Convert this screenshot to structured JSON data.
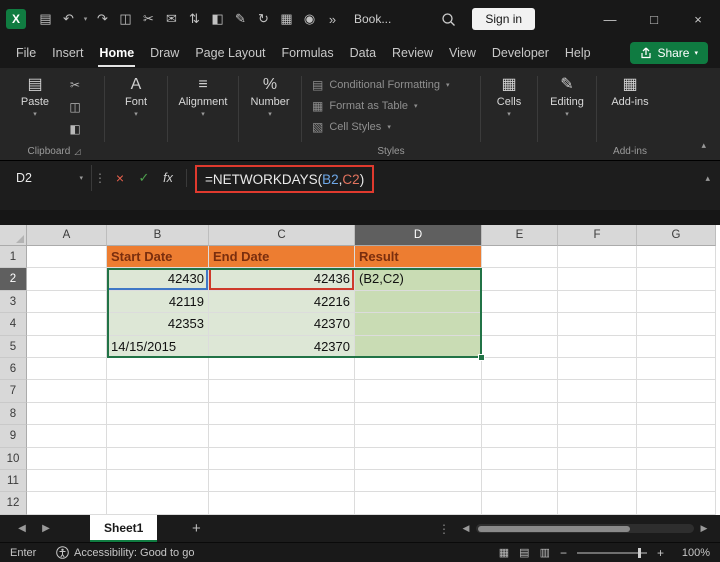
{
  "titlebar": {
    "qat": [
      {
        "name": "save-icon",
        "glyph": "▤"
      },
      {
        "name": "undo-icon",
        "glyph": "↶"
      },
      {
        "name": "undo-dropdown-icon",
        "glyph": "▾"
      },
      {
        "name": "redo-icon",
        "glyph": "↷"
      },
      {
        "name": "copy-icon",
        "glyph": "◫"
      },
      {
        "name": "cut-icon",
        "glyph": "✂"
      },
      {
        "name": "mail-icon",
        "glyph": "✉"
      },
      {
        "name": "sort-icon",
        "glyph": "⇅"
      },
      {
        "name": "format-painter-icon",
        "glyph": "◧"
      },
      {
        "name": "pen-icon",
        "glyph": "✎"
      },
      {
        "name": "rotate-icon",
        "glyph": "↻"
      },
      {
        "name": "table-icon",
        "glyph": "▦"
      },
      {
        "name": "camera-icon",
        "glyph": "◉"
      },
      {
        "name": "more-commands-icon",
        "glyph": "»"
      }
    ],
    "workbook_name": "Book...",
    "sign_in_label": "Sign in",
    "window": {
      "minimize": "—",
      "maximize": "□",
      "close": "×"
    }
  },
  "menubar": {
    "items": [
      "File",
      "Insert",
      "Home",
      "Draw",
      "Page Layout",
      "Formulas",
      "Data",
      "Review",
      "View",
      "Developer",
      "Help"
    ],
    "active_item": "Home",
    "share_label": "Share"
  },
  "ribbon": {
    "paste": {
      "glyph": "▤",
      "label": "Paste"
    },
    "mini": [
      {
        "glyph": "✂"
      },
      {
        "glyph": "◫"
      },
      {
        "glyph": "◧"
      }
    ],
    "big": [
      {
        "glyph": "A",
        "label": "Font"
      },
      {
        "glyph": "≡",
        "label": "Alignment"
      },
      {
        "glyph": "%",
        "label": "Number"
      }
    ],
    "styles": [
      {
        "glyph": "▤",
        "label": "Conditional Formatting"
      },
      {
        "glyph": "▦",
        "label": "Format as Table"
      },
      {
        "glyph": "▧",
        "label": "Cell Styles"
      }
    ],
    "right": [
      {
        "glyph": "▦",
        "label": "Cells"
      },
      {
        "glyph": "✎",
        "label": "Editing"
      },
      {
        "glyph": "▦",
        "label": "Add-ins"
      }
    ],
    "captions": {
      "clipboard": "Clipboard",
      "styles": "Styles",
      "addins": "Add-ins"
    },
    "launcher_glyph": "◿",
    "collapse_glyph": "▴"
  },
  "ui": {
    "caret": "▾",
    "dots": "⋮"
  },
  "formula_bar": {
    "name_box": "D2",
    "cancel_glyph": "×",
    "enter_glyph": "✓",
    "fx_label": "fx",
    "formula": {
      "prefix": "=NETWORKDAYS(",
      "ref1": "B2",
      "sep": ",",
      "ref2": "C2",
      "suffix": ")"
    },
    "collapse_glyph": "▴"
  },
  "grid": {
    "columns": [
      "A",
      "B",
      "C",
      "D",
      "E",
      "F",
      "G"
    ],
    "col_widths": {
      "A": 80,
      "B": 102,
      "C": 146,
      "D": 127,
      "E": 76,
      "F": 79,
      "G": 79
    },
    "rows": [
      "1",
      "2",
      "3",
      "4",
      "5",
      "6",
      "7",
      "8",
      "9",
      "10",
      "11",
      "12"
    ],
    "active_col": "D",
    "active_row": "2",
    "active_cell": "D2",
    "cells": {
      "B1": {
        "v": "Start Date",
        "cls": "hdr"
      },
      "C1": {
        "v": "End Date",
        "cls": "hdr"
      },
      "D1": {
        "v": "Result",
        "cls": "hdr"
      },
      "B2": {
        "v": "42430",
        "cls": "in num ref-blue"
      },
      "C2": {
        "v": "42436",
        "cls": "in num ref-red"
      },
      "D2": {
        "v": "(B2,C2)",
        "cls": "res"
      },
      "B3": {
        "v": "42119",
        "cls": "in num"
      },
      "C3": {
        "v": "42216",
        "cls": "in num"
      },
      "D3": {
        "v": "",
        "cls": "res"
      },
      "B4": {
        "v": "42353",
        "cls": "in num"
      },
      "C4": {
        "v": "42370",
        "cls": "in num"
      },
      "D4": {
        "v": "",
        "cls": "res"
      },
      "B5": {
        "v": "14/15/2015",
        "cls": "in"
      },
      "C5": {
        "v": "42370",
        "cls": "in num"
      },
      "D5": {
        "v": "",
        "cls": "res"
      }
    }
  },
  "sheet_bar": {
    "nav_left": "◀",
    "nav_right": "▶",
    "tab": "Sheet1",
    "add": "+",
    "dots": "⋮",
    "scroll_left": "◀",
    "scroll_right": "▶"
  },
  "status_bar": {
    "mode": "Enter",
    "accessibility": "Accessibility: Good to go",
    "views": [
      {
        "glyph": "▦"
      },
      {
        "glyph": "▤"
      },
      {
        "glyph": "▥"
      }
    ],
    "zoom_out": "−",
    "zoom_in": "+",
    "zoom_level": "100%"
  },
  "colors": {
    "excel_green": "#107C41",
    "annotation_red": "#E03A2E",
    "header_fill": "#ED7D31",
    "header_text": "#7A2E0E",
    "input_fill": "#DDE7D6",
    "result_fill": "#C9DCB4",
    "ref1_border": "#3F77C6",
    "ref2_border": "#CE3A2B",
    "formula_ref1": "#6FA8E8",
    "formula_ref2": "#E2735E"
  }
}
